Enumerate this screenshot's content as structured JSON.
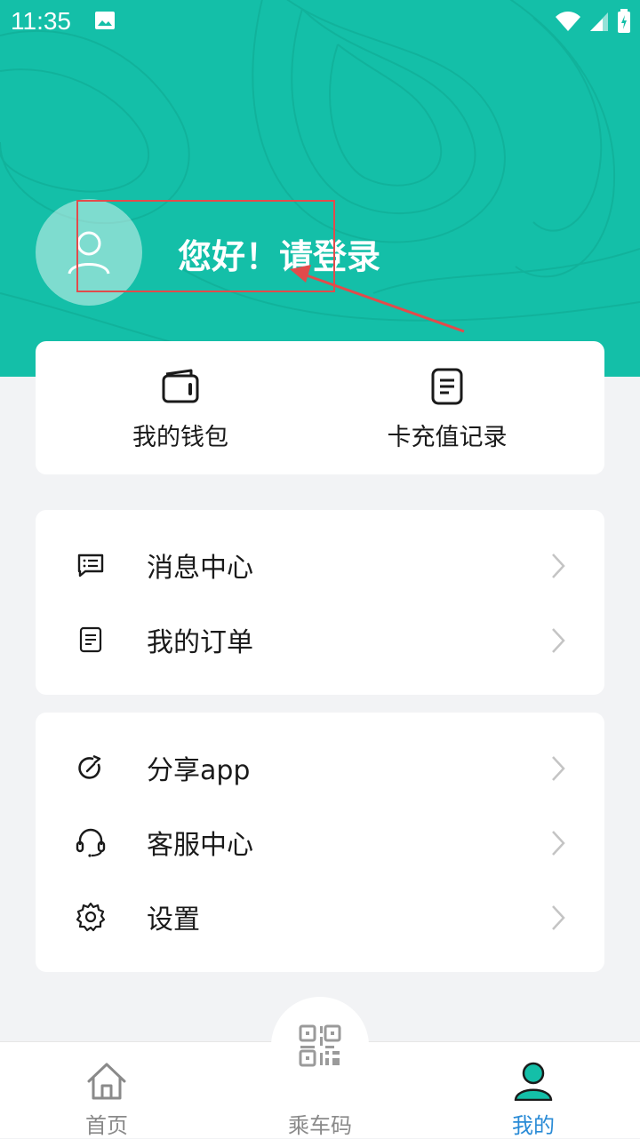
{
  "status_bar": {
    "time": "11:35"
  },
  "header": {
    "greeting": "您好！请登录",
    "bg_color": "#14bfa8"
  },
  "quick_actions": [
    {
      "label": "我的钱包",
      "icon": "wallet-icon"
    },
    {
      "label": "卡充值记录",
      "icon": "document-icon"
    }
  ],
  "menu_group_1": [
    {
      "label": "消息中心",
      "icon": "message-icon"
    },
    {
      "label": "我的订单",
      "icon": "order-icon"
    }
  ],
  "menu_group_2": [
    {
      "label": "分享app",
      "icon": "share-icon"
    },
    {
      "label": "客服中心",
      "icon": "headset-icon"
    },
    {
      "label": "设置",
      "icon": "gear-icon"
    }
  ],
  "tab_bar": {
    "home": "首页",
    "ride_code": "乘车码",
    "mine": "我的",
    "active_color": "#2a8bd6",
    "inactive_color": "#8a8a8a"
  }
}
